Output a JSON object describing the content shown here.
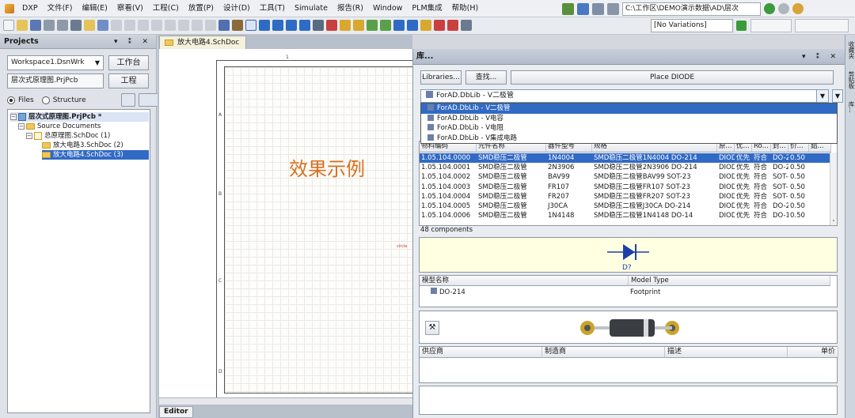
{
  "menubar": {
    "items": [
      "DXP",
      "文件(F)",
      "编辑(E)",
      "察看(V)",
      "工程(C)",
      "放置(P)",
      "设计(D)",
      "工具(T)",
      "Simulate",
      "报告(R)",
      "Window",
      "PLM集成",
      "帮助(H)"
    ],
    "path": "C:\\工作区\\DEMO演示数据\\AD\\层次"
  },
  "toolbar": {
    "variations": "[No Variations]"
  },
  "projects_panel": {
    "title": "Projects",
    "controls": "▾ ⁑ ✕",
    "workspace_combo": "Workspace1.DsnWrk",
    "workspace_button": "工作台",
    "project_combo": "层次式原理图.PrjPcb",
    "project_button": "工程",
    "radio_files": "Files",
    "radio_structure": "Structure",
    "tree": {
      "project": "层次式原理图.PrjPcb *",
      "source_documents": "Source Documents",
      "master_sheet": "总原理图.SchDoc (1)",
      "child1": "放大电路3.SchDoc (2)",
      "child2": "放大电路4.SchDoc (3)"
    }
  },
  "document": {
    "tab": "放大电路4.SchDoc",
    "overlay_text": "效果示例",
    "zone_letters": [
      "A",
      "B",
      "C",
      "D"
    ],
    "editor_tab": "Editor",
    "pin_label": "circle",
    "top_ruler": "1"
  },
  "library_panel": {
    "title": "库...",
    "controls": "▾ ⁑ ✕",
    "libraries_button": "Libraries...",
    "search_button": "查找...",
    "place_button": "Place DIODE",
    "selected_library": "ForAD.DbLib - V二极管",
    "dropdown_options": [
      "ForAD.DbLib - V二极管",
      "ForAD.DbLib - V电容",
      "ForAD.DbLib - V电阻",
      "ForAD.DbLib - V集成电路"
    ],
    "selected_option_index": 0,
    "columns": [
      "物料编码",
      "元件名称",
      "器件型号",
      "规格",
      "原...",
      "优...",
      "Ro...",
      "封...",
      "价...",
      "鋁..."
    ],
    "rows": [
      [
        "1.05.104.0000",
        "SMD稳压二极管",
        "1N4004",
        "SMD稳压二极管1N4004 DO-214",
        "DIOD",
        "优先",
        "符合",
        "DO-2",
        "0.50"
      ],
      [
        "1.05.104.0001",
        "SMD稳压二极管",
        "2N3906",
        "SMD稳压二极管2N3906 DO-214",
        "DIOD",
        "优先",
        "符合",
        "DO-2",
        "0.50"
      ],
      [
        "1.05.104.0002",
        "SMD稳压二极管",
        "BAV99",
        "SMD稳压二极管BAV99 SOT-23",
        "DIOD",
        "优先",
        "符合",
        "SOT-:",
        "0.50"
      ],
      [
        "1.05.104.0003",
        "SMD稳压二极管",
        "FR107",
        "SMD稳压二极管FR107 SOT-23",
        "DIOD",
        "优先",
        "符合",
        "SOT-:",
        "0.50"
      ],
      [
        "1.05.104.0004",
        "SMD稳压二极管",
        "FR207",
        "SMD稳压二极管FR207 SOT-23",
        "DIOD",
        "优先",
        "符合",
        "SOT-:",
        "0.50"
      ],
      [
        "1.05.104.0005",
        "SMD稳压二极管",
        "J30CA",
        "SMD稳压二极管J30CA DO-214",
        "DIOD",
        "优先",
        "符合",
        "DO-2",
        "0.50"
      ],
      [
        "1.05.104.0006",
        "SMD稳压二极管",
        "1N4148",
        "SMD稳压二极管1N4148 DO-14",
        "DIOD",
        "优先",
        "符合",
        "DO-1",
        "0.50"
      ]
    ],
    "selected_row_index": 0,
    "component_count": "48 components",
    "symbol_designator": "D?",
    "model_headers": [
      "模型名称",
      "Model Type"
    ],
    "model_row": {
      "name": "DO-214",
      "type": "Footprint"
    },
    "supplier_headers": [
      "供应商",
      "制造商",
      "描述",
      "单价"
    ]
  },
  "side_tabs": [
    "收藏夹",
    "剪贴板",
    "库..."
  ]
}
